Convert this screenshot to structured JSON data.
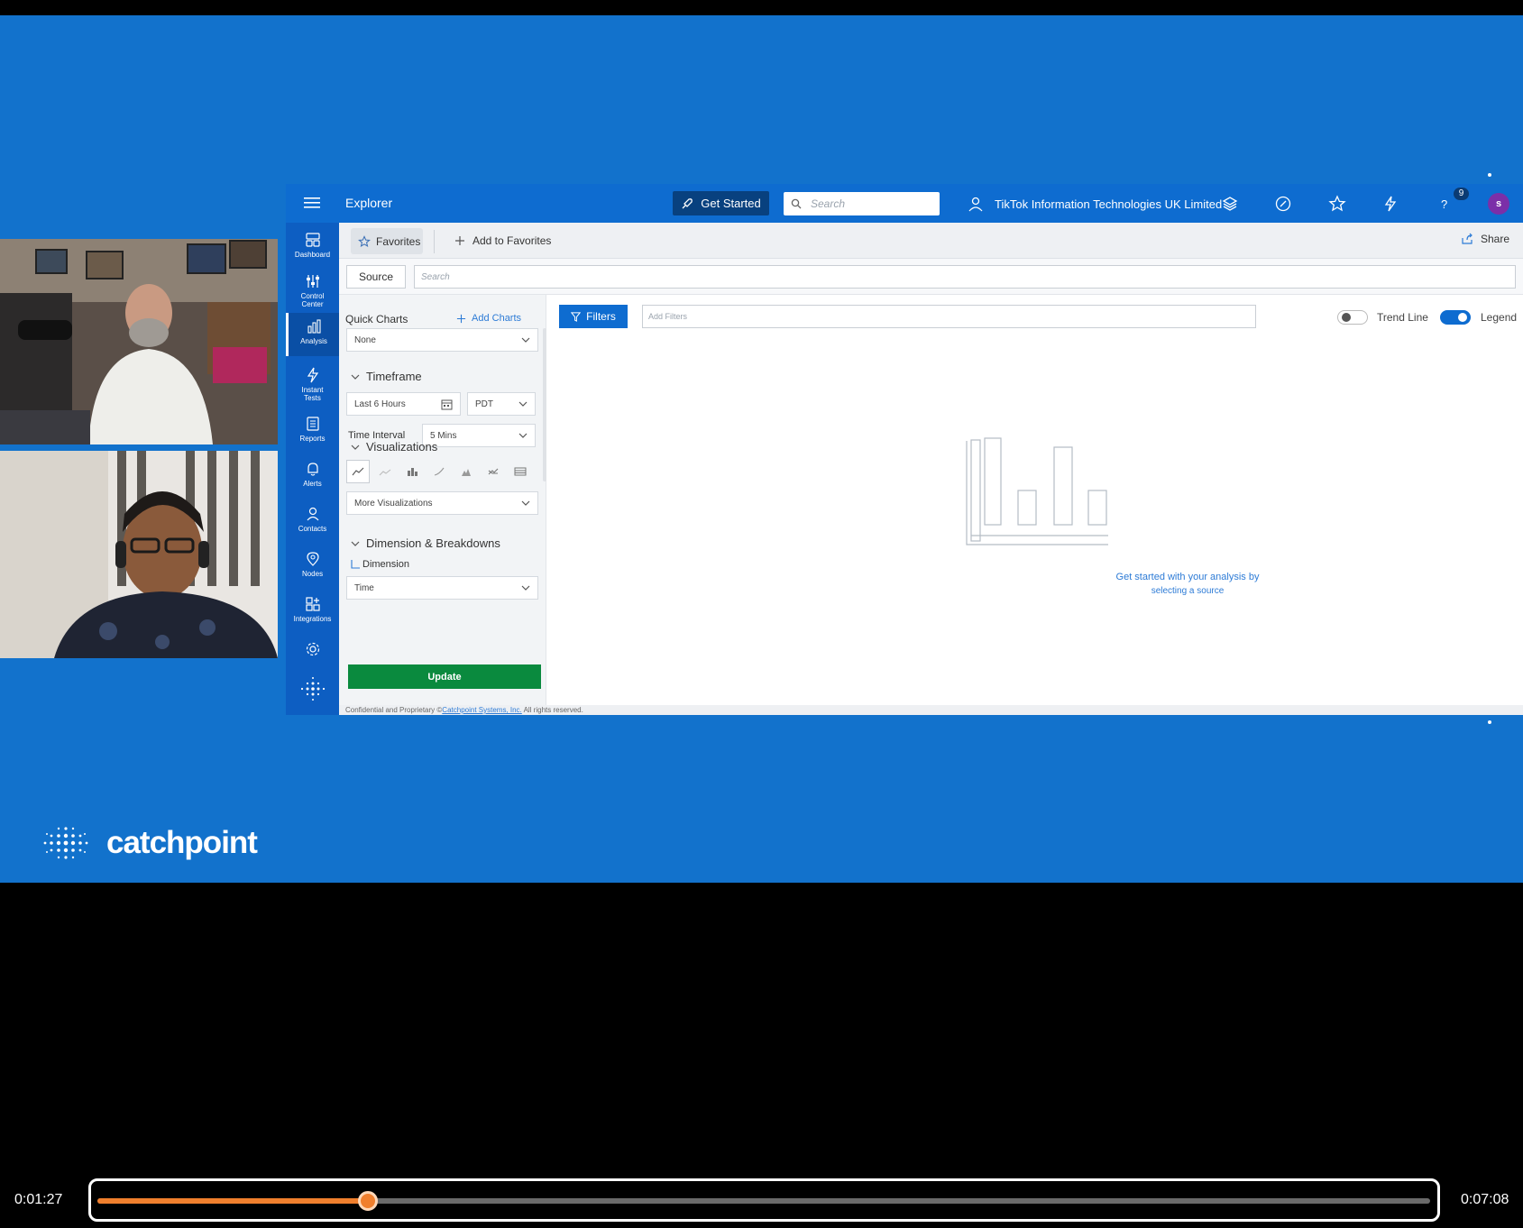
{
  "app": {
    "title": "Explorer",
    "get_started": "Get Started",
    "search_placeholder": "Search",
    "org_name": "TikTok Information Technologies UK Limited",
    "notification_count": "9",
    "avatar_initial": "s"
  },
  "nav": [
    {
      "label": "Dashboard",
      "icon": "dashboard-icon"
    },
    {
      "label": "Control Center",
      "icon": "sliders-icon"
    },
    {
      "label": "Analysis",
      "icon": "bar-chart-icon"
    },
    {
      "label": "Instant Tests",
      "icon": "lightning-icon"
    },
    {
      "label": "Reports",
      "icon": "report-icon"
    },
    {
      "label": "Alerts",
      "icon": "bell-icon"
    },
    {
      "label": "Contacts",
      "icon": "person-icon"
    },
    {
      "label": "Nodes",
      "icon": "location-pin-icon"
    },
    {
      "label": "Integrations",
      "icon": "plus-grid-icon"
    }
  ],
  "favbar": {
    "favorites": "Favorites",
    "add_to_favorites": "Add to Favorites",
    "share": "Share"
  },
  "sourcebar": {
    "source": "Source",
    "search_placeholder": "Search"
  },
  "panel": {
    "quick_charts": "Quick Charts",
    "add_charts": "Add Charts",
    "quick_chart_value": "None",
    "timeframe_title": "Timeframe",
    "timeframe_value": "Last 6 Hours",
    "timezone_value": "PDT",
    "time_interval_label": "Time Interval",
    "time_interval_value": "5 Mins",
    "visualizations_title": "Visualizations",
    "more_visualizations": "More Visualizations",
    "dimension_title": "Dimension & Breakdowns",
    "dimension_label": "Dimension",
    "dimension_value": "Time",
    "update": "Update"
  },
  "filters": {
    "filters_label": "Filters",
    "add_filters_placeholder": "Add Filters",
    "trend_line": "Trend Line",
    "trend_line_on": false,
    "legend": "Legend",
    "legend_on": true
  },
  "empty_state": {
    "line1": "Get started with your analysis by",
    "line2": "selecting a source"
  },
  "footer": {
    "prefix": "Confidential and Proprietary ©",
    "link": "Catchpoint Systems, Inc.",
    "suffix": " All rights reserved."
  },
  "brand": "catchpoint",
  "player": {
    "current_time": "0:01:27",
    "total_time": "0:07:08",
    "progress_fraction": 0.2032
  },
  "colors": {
    "background_blue": "#1272cc",
    "accent_orange": "#f07f2d",
    "update_green": "#0a8a3e"
  }
}
